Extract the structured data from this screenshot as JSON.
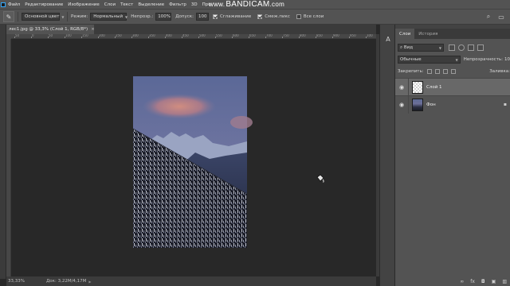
{
  "menu": {
    "items": [
      "Файл",
      "Редактирование",
      "Изображение",
      "Слои",
      "Текст",
      "Выделение",
      "Фильтр",
      "3D",
      "Про"
    ]
  },
  "watermark": {
    "prefix": "www.",
    "brand": "BANDICAM",
    "suffix": ".com"
  },
  "options": {
    "tool_icon": "brush-icon",
    "source_label": "Основной цвет",
    "mode_label": "Режим:",
    "mode_value": "Нормальный",
    "opacity_label": "Непрозр.:",
    "opacity_value": "100%",
    "tolerance_label": "Допуск:",
    "tolerance_value": "100",
    "antialias_label": "Сглаживание",
    "antialias_checked": true,
    "contiguous_label": "Смеж.пикс",
    "contiguous_checked": true,
    "all_layers_label": "Все слои",
    "all_layers_checked": false
  },
  "document": {
    "tab_title": "лес1.jpg @ 33,3% (Слой 1, RGB/8*)",
    "tab_close": "×",
    "ruler_labels": [
      "50",
      "0",
      "50",
      "100",
      "150",
      "200",
      "250",
      "300",
      "350",
      "400",
      "450",
      "500",
      "550",
      "600",
      "650",
      "700",
      "750",
      "800",
      "850",
      "900",
      "950",
      "100"
    ]
  },
  "status": {
    "zoom": "33,33%",
    "doc_info": "Док: 3,22M/4,17M",
    "arrow": "▶"
  },
  "layers_panel": {
    "tabs": [
      "Слои",
      "История"
    ],
    "active_tab": 0,
    "filter_value": "Вид",
    "blend_mode": "Обычные",
    "opacity_label": "Непрозрачность:",
    "opacity_value": "10",
    "lock_label": "Закрепить:",
    "fill_label": "Заливка:",
    "layers": [
      {
        "name": "Слой 1",
        "visible": true,
        "selected": true,
        "locked": false,
        "thumb": "transparent"
      },
      {
        "name": "Фон",
        "visible": true,
        "selected": false,
        "locked": true,
        "thumb": "photo"
      }
    ]
  },
  "colors": {
    "panel_bg": "#535353",
    "canvas_bg": "#282828",
    "accent": "#31a8ff",
    "sky_top": "#5d6a9a",
    "cloud": "#c98a7e"
  }
}
